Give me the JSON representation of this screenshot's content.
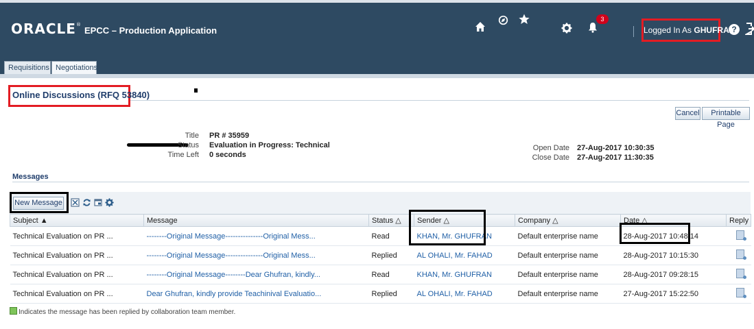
{
  "app": {
    "logo": "ORACLE",
    "logo_mark": "®",
    "title": "EPCC – Production Application",
    "notification_count": "3",
    "logged_in_prefix": "Logged In As",
    "logged_in_user": "GHUFRAN"
  },
  "tabs": [
    "Requisitions",
    "Negotiations"
  ],
  "page": {
    "title": "Online Discussions (RFQ 53840)",
    "cancel_label": "Cancel",
    "printable_label": "Printable Page"
  },
  "details": {
    "title_label": "Title",
    "title_value": "PR # 35959",
    "status_label": "Status",
    "status_value": "Evaluation in Progress: Technical",
    "timeleft_label": "Time Left",
    "timeleft_value": "0 seconds",
    "open_label": "Open Date",
    "open_value": "27-Aug-2017 10:30:35",
    "close_label": "Close Date",
    "close_value": "27-Aug-2017 11:30:35"
  },
  "messages": {
    "section_title": "Messages",
    "new_message_label": "New Message",
    "columns": [
      "Subject ▲",
      "Message",
      "Status △",
      "Sender △",
      "Company △",
      "Date △",
      "Reply"
    ],
    "rows": [
      {
        "subject": "Technical Evaluation on PR ...",
        "message": "--------Original Message---------------Original Mess...",
        "status": "Read",
        "sender": "KHAN, Mr. GHUFRAN",
        "company": "Default enterprise name",
        "date": "28-Aug-2017 10:48:14"
      },
      {
        "subject": "Technical Evaluation on PR ...",
        "message": "--------Original Message---------------Original Mess...",
        "status": "Replied",
        "sender": "AL OHALI, Mr. FAHAD",
        "company": "Default enterprise name",
        "date": "28-Aug-2017 10:15:30"
      },
      {
        "subject": "Technical Evaluation on PR ...",
        "message": "--------Original Message--------Dear Ghufran, kindly...",
        "status": "Read",
        "sender": "KHAN, Mr. GHUFRAN",
        "company": "Default enterprise name",
        "date": "28-Aug-2017 09:28:15"
      },
      {
        "subject": "Technical Evaluation on PR ...",
        "message": "Dear Ghufran, kindly provide Teachinival Evaluatio...",
        "status": "Replied",
        "sender": "AL OHALI, Mr. FAHAD",
        "company": "Default enterprise name",
        "date": "27-Aug-2017 15:22:50"
      }
    ],
    "footnote": "Indicates the message has been replied by collaboration team member."
  },
  "colors": {
    "header_bg": "#2e4a62",
    "highlight_red": "#e31c23",
    "link_blue": "#1f5fa6",
    "badge_red": "#d0021b"
  },
  "icons": [
    "home-icon",
    "compass-icon",
    "star-icon",
    "gear-icon",
    "bell-icon",
    "help-icon",
    "signout-icon",
    "export-icon",
    "refresh-icon",
    "detach-icon",
    "settings-icon",
    "reply-icon",
    "replied-indicator-icon"
  ]
}
